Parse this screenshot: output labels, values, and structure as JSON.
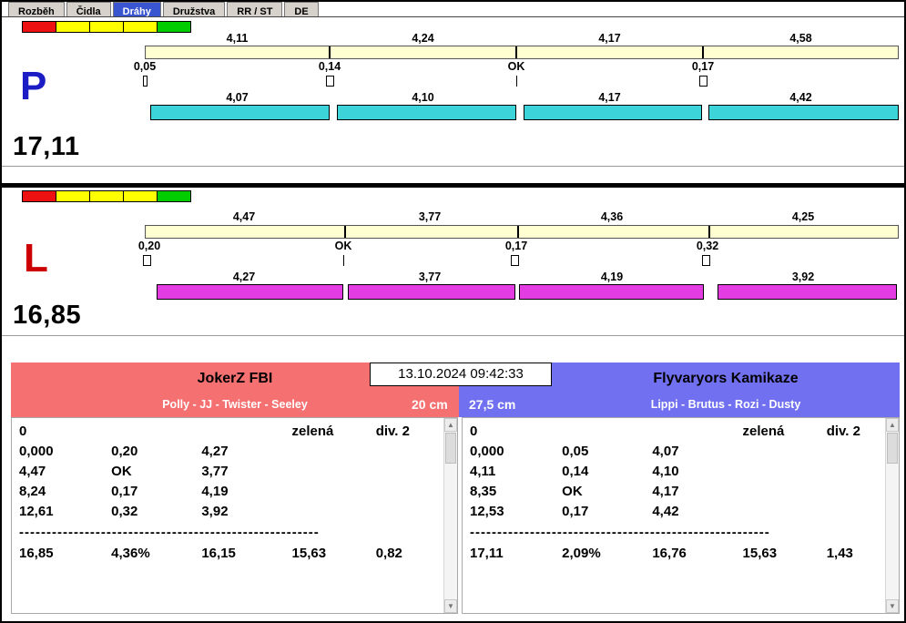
{
  "colors": {
    "tab_selected": "#3a55d0",
    "split_bar_bg": "#ffffd2",
    "bar_right": "#3cd4d8",
    "bar_left": "#e23ce2",
    "team_left_bg": "#f57070",
    "team_right_bg": "#7070f0",
    "lane_right_letter": "#1c1cc4",
    "lane_left_letter": "#cc0000",
    "light_red": "#ee1111",
    "light_yellow": "#ffff00",
    "light_green": "#00cc00"
  },
  "tabs": [
    "Rozběh",
    "Čidla",
    "Dráhy",
    "Družstva",
    "RR / ST",
    "DE"
  ],
  "selected_tab": "Dráhy",
  "lane_right": {
    "letter": "P",
    "total": "17,11",
    "splits": [
      "4,11",
      "4,24",
      "4,17",
      "4,58"
    ],
    "markers": [
      "0,05",
      "0,14",
      "OK",
      "0,17"
    ],
    "times": [
      "4,07",
      "4,10",
      "4,17",
      "4,42"
    ]
  },
  "lane_left": {
    "letter": "L",
    "total": "16,85",
    "splits": [
      "4,47",
      "3,77",
      "4,36",
      "4,25"
    ],
    "markers": [
      "0,20",
      "OK",
      "0,17",
      "0,32"
    ],
    "times": [
      "4,27",
      "3,77",
      "4,19",
      "3,92"
    ]
  },
  "timestamp": "13.10.2024 09:42:33",
  "team_left": {
    "name": "JokerZ FBI",
    "lineup": "Polly - JJ - Twister - Seeley",
    "jump_height": "20 cm",
    "info_row": [
      "0",
      "",
      "",
      "zelená",
      "div. 2"
    ],
    "rows": [
      [
        "0,000",
        "0,20",
        "4,27"
      ],
      [
        "4,47",
        "OK",
        "3,77"
      ],
      [
        "8,24",
        "0,17",
        "4,19"
      ],
      [
        "12,61",
        "0,32",
        "3,92"
      ]
    ],
    "separator": "--------------------------------------------------------------",
    "summary": [
      "16,85",
      "4,36%",
      "16,15",
      "15,63",
      "0,82"
    ]
  },
  "team_right": {
    "name": "Flyvaryors Kamikaze",
    "lineup": "Lippi - Brutus - Rozi - Dusty",
    "jump_height": "27,5 cm",
    "info_row": [
      "0",
      "",
      "",
      "zelená",
      "div. 2"
    ],
    "rows": [
      [
        "0,000",
        "0,05",
        "4,07"
      ],
      [
        "4,11",
        "0,14",
        "4,10"
      ],
      [
        "8,35",
        "OK",
        "4,17"
      ],
      [
        "12,53",
        "0,17",
        "4,42"
      ]
    ],
    "separator": "--------------------------------------------------------------",
    "summary": [
      "17,11",
      "2,09%",
      "16,76",
      "15,63",
      "1,43"
    ]
  }
}
